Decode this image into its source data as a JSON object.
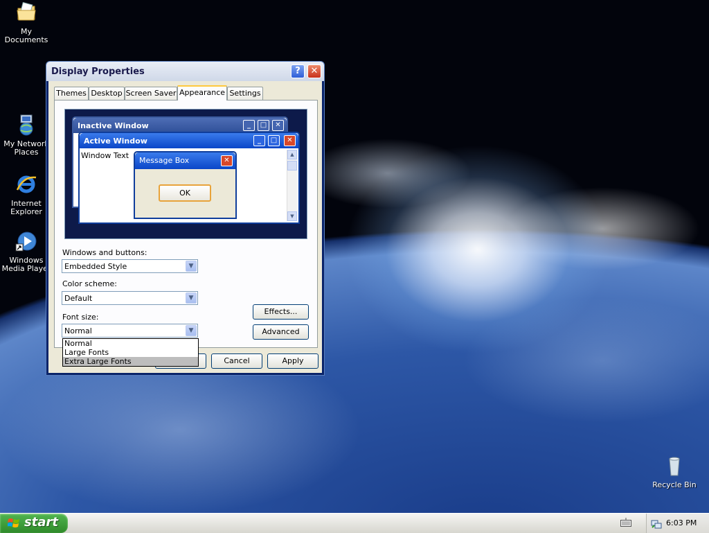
{
  "desktop": {
    "icons": [
      {
        "label": "My Documents",
        "icon": "my-documents-icon"
      },
      {
        "label": "My Network Places",
        "icon": "network-places-icon"
      },
      {
        "label": "Internet Explorer",
        "icon": "internet-explorer-icon"
      },
      {
        "label": "Windows Media Player",
        "icon": "media-player-icon"
      },
      {
        "label": "Recycle Bin",
        "icon": "recycle-bin-icon"
      }
    ]
  },
  "window": {
    "title": "Display Properties",
    "help_label": "?",
    "close_label": "✕",
    "tabs": [
      {
        "label": "Themes"
      },
      {
        "label": "Desktop"
      },
      {
        "label": "Screen Saver"
      },
      {
        "label": "Appearance"
      },
      {
        "label": "Settings"
      }
    ],
    "selected_tab": "Appearance",
    "preview": {
      "inactive_title": "Inactive Window",
      "active_title": "Active Window",
      "window_text": "Window Text",
      "message_box_title": "Message Box",
      "ok_label": "OK",
      "minimize_glyph": "_",
      "maximize_glyph": "□",
      "close_glyph": "✕"
    },
    "windows_buttons": {
      "label": "Windows and buttons:",
      "value": "Embedded Style"
    },
    "color_scheme": {
      "label": "Color scheme:",
      "value": "Default"
    },
    "font_size": {
      "label": "Font size:",
      "value": "Normal",
      "options": [
        "Normal",
        "Large Fonts",
        "Extra Large Fonts"
      ],
      "highlighted": "Extra Large Fonts"
    },
    "effects_label": "Effects...",
    "advanced_label": "Advanced",
    "cancel_label": "Cancel",
    "apply_label": "Apply"
  },
  "taskbar": {
    "start_label": "start",
    "clock": "6:03 PM"
  }
}
